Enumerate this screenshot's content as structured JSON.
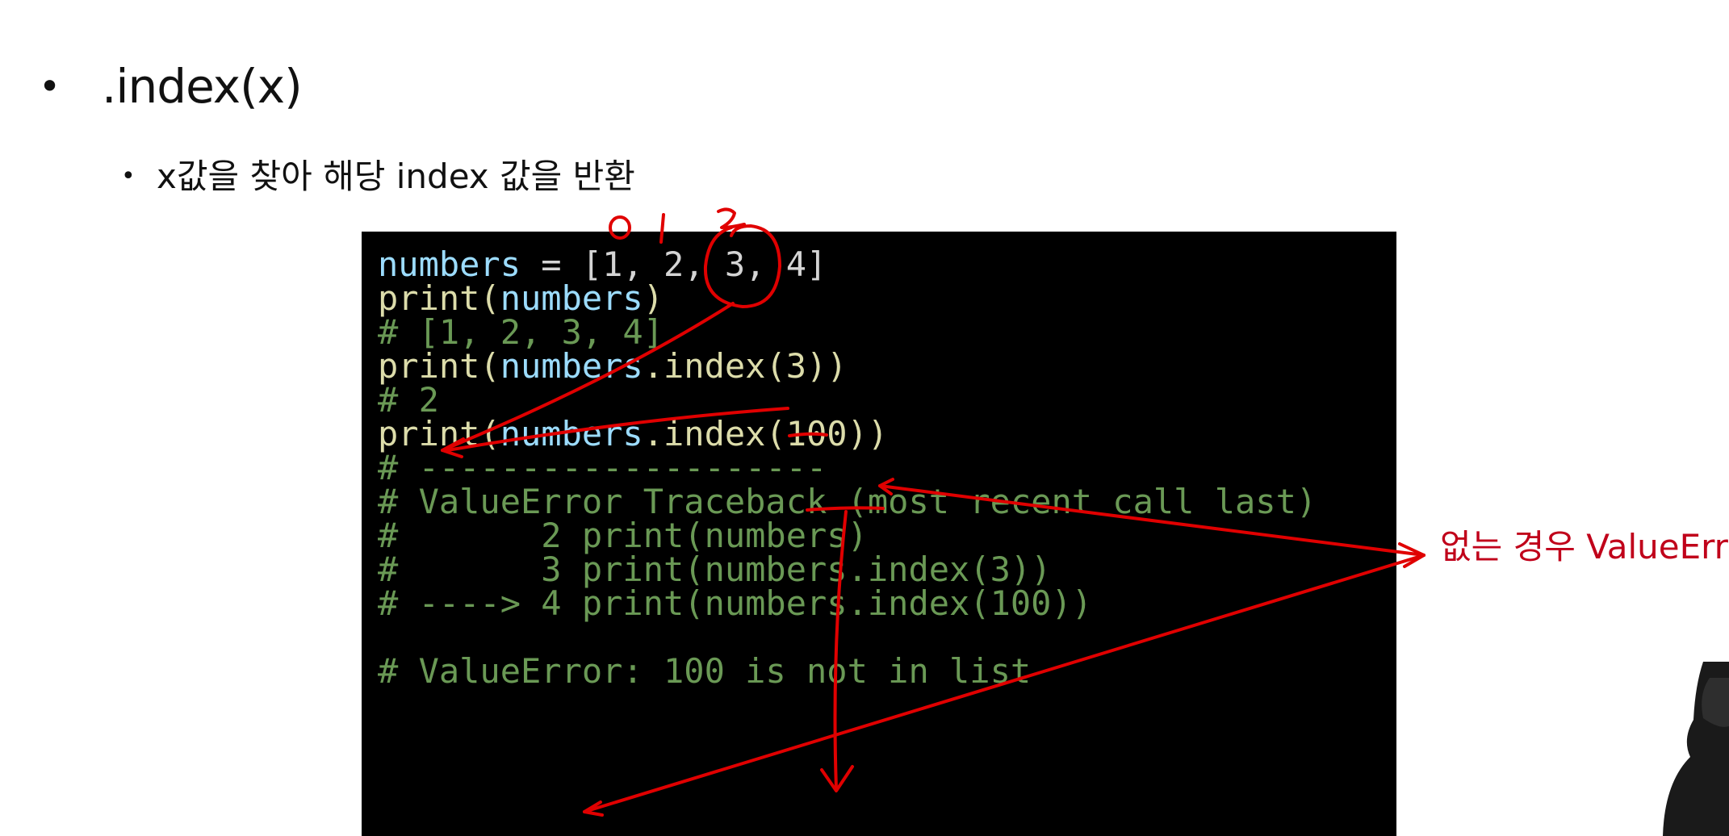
{
  "slide": {
    "heading": ".index(x)",
    "subheading": "x값을 찾아 해당 index 값을 반환",
    "side_note": "없는 경우 ValueError"
  },
  "code": {
    "lines": [
      {
        "segments": [
          {
            "text": "numbers",
            "kind": "var"
          },
          {
            "text": " = [1, 2, 3, 4]",
            "kind": "op"
          }
        ]
      },
      {
        "segments": [
          {
            "text": "print(",
            "kind": "fn"
          },
          {
            "text": "numbers",
            "kind": "var"
          },
          {
            "text": ")",
            "kind": "fn"
          }
        ]
      },
      {
        "segments": [
          {
            "text": "# [1, 2, 3, 4]",
            "kind": "com"
          }
        ]
      },
      {
        "segments": [
          {
            "text": "print(",
            "kind": "fn"
          },
          {
            "text": "numbers",
            "kind": "var"
          },
          {
            "text": ".index(3))",
            "kind": "fn"
          }
        ]
      },
      {
        "segments": [
          {
            "text": "# 2",
            "kind": "com"
          }
        ]
      },
      {
        "segments": [
          {
            "text": "print(",
            "kind": "fn"
          },
          {
            "text": "numbers",
            "kind": "var"
          },
          {
            "text": ".index(100))",
            "kind": "fn"
          }
        ]
      },
      {
        "segments": [
          {
            "text": "# --------------------",
            "kind": "com"
          }
        ]
      },
      {
        "segments": [
          {
            "text": "# ValueError Traceback (most recent call last)",
            "kind": "com"
          }
        ]
      },
      {
        "segments": [
          {
            "text": "#       2 print(numbers)",
            "kind": "com"
          }
        ]
      },
      {
        "segments": [
          {
            "text": "#       3 print(numbers.index(3))",
            "kind": "com"
          }
        ]
      },
      {
        "segments": [
          {
            "text": "# ----> 4 print(numbers.index(100))",
            "kind": "com"
          }
        ]
      },
      {
        "segments": [
          {
            "text": "",
            "kind": "com"
          }
        ]
      },
      {
        "segments": [
          {
            "text": "# ValueError: 100 is not in list",
            "kind": "com"
          }
        ]
      }
    ]
  },
  "handwriting": {
    "index_labels": [
      "0",
      "1",
      "2"
    ],
    "ink_color": "#e00000"
  },
  "colors": {
    "code_bg": "#000000",
    "variable": "#9cdcfe",
    "function": "#dcdcaa",
    "comment": "#6a9955",
    "note": "#c0001a"
  }
}
